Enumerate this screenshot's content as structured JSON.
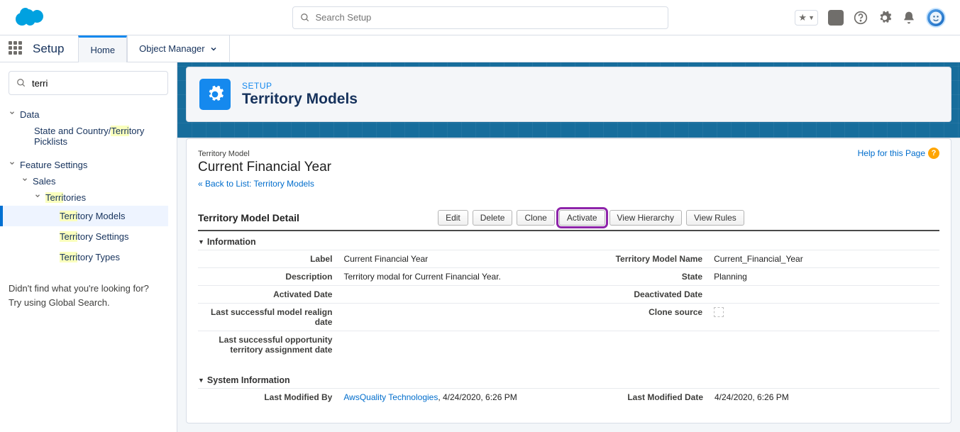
{
  "header": {
    "search_placeholder": "Search Setup"
  },
  "nav": {
    "app_name": "Setup",
    "tabs": [
      {
        "label": "Home",
        "active": true
      },
      {
        "label": "Object Manager",
        "active": false
      }
    ]
  },
  "sidebar": {
    "search_value": "terri",
    "groups": [
      {
        "label": "Data",
        "level": 0
      },
      {
        "label_pre": "State and Country/",
        "label_hl": "Terri",
        "label_post": "tory Picklists",
        "level": 1,
        "leaf": true
      },
      {
        "label": "Feature Settings",
        "level": 0
      },
      {
        "label": "Sales",
        "level": 1
      },
      {
        "label_hl": "Terri",
        "label_post": "tories",
        "level": 2
      },
      {
        "label_hl": "Terri",
        "label_post": "tory Models",
        "level": 3,
        "leaf": true,
        "active": true
      },
      {
        "label_hl": "Terri",
        "label_post": "tory Settings",
        "level": 3,
        "leaf": true
      },
      {
        "label_hl": "Terri",
        "label_post": "tory Types",
        "level": 3,
        "leaf": true
      }
    ],
    "footer_line1": "Didn't find what you're looking for?",
    "footer_line2": "Try using Global Search."
  },
  "page": {
    "eyebrow": "SETUP",
    "title": "Territory Models",
    "help_label": "Help for this Page",
    "breadcrumb_small": "Territory Model",
    "breadcrumb_title": "Current Financial Year",
    "back_link": "« Back to List: Territory Models",
    "detail_title": "Territory Model Detail",
    "buttons": [
      "Edit",
      "Delete",
      "Clone",
      "Activate",
      "View Hierarchy",
      "View Rules"
    ],
    "highlight_button": "Activate",
    "sections": {
      "info_title": "Information",
      "sys_title": "System Information"
    },
    "fields": {
      "label_txt": "Label",
      "label_val": "Current Financial Year",
      "tmn_txt": "Territory Model Name",
      "tmn_val": "Current_Financial_Year",
      "desc_txt": "Description",
      "desc_val": "Territory modal for Current Financial Year.",
      "state_txt": "State",
      "state_val": "Planning",
      "act_date_txt": "Activated Date",
      "act_date_val": "",
      "deact_date_txt": "Deactivated Date",
      "deact_date_val": "",
      "realign_txt": "Last successful model realign date",
      "realign_val": "",
      "clone_txt": "Clone source",
      "opp_txt": "Last successful opportunity territory assignment date",
      "opp_val": "",
      "mod_by_txt": "Last Modified By",
      "mod_by_user": "AwsQuality Technologies",
      "mod_by_date": ", 4/24/2020, 6:26 PM",
      "mod_date_txt": "Last Modified Date",
      "mod_date_val": "4/24/2020, 6:26 PM"
    }
  }
}
